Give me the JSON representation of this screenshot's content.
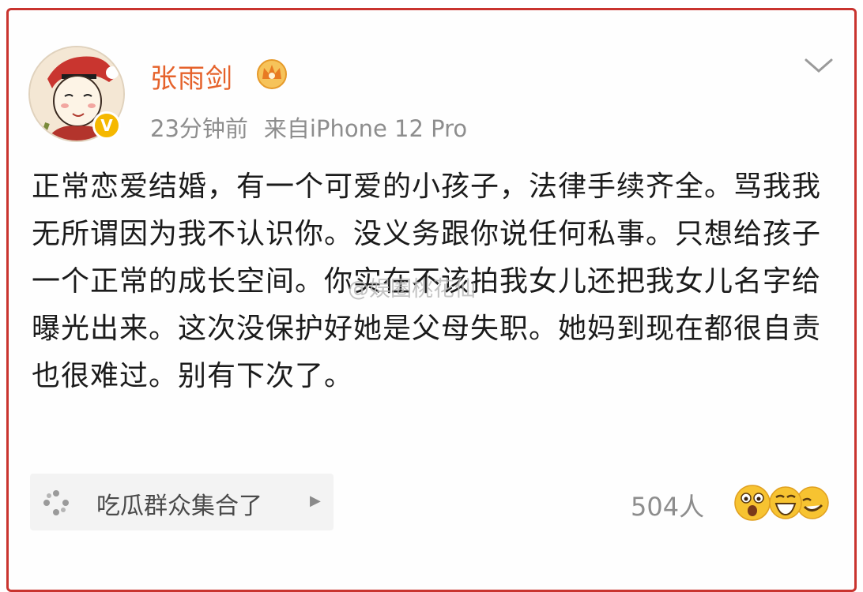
{
  "post": {
    "author": "张雨剑",
    "time": "23分钟前",
    "source": "来自iPhone 12 Pro",
    "text": "正常恋爱结婚，有一个可爱的小孩子，法律手续齐全。骂我我无所谓因为我不认识你。没义务跟你说任何私事。只想给孩子一个正常的成长空间。你实在不该拍我女儿还把我女儿名字给曝光出来。这次没保护好她是父母失职。她妈到现在都很自责也很难过。别有下次了。",
    "watermark": "@娱圈桃花仙"
  },
  "topic": {
    "label": "吃瓜群众集合了"
  },
  "reactions": {
    "count": "504人",
    "emoji_icons": [
      "shocked-face-icon",
      "laughing-face-icon",
      "grinning-face-icon"
    ]
  },
  "icons": {
    "verified": "verified-v-icon",
    "member_badge": "crown-badge-icon",
    "menu": "chevron-down-icon",
    "topic": "sparkle-icon"
  },
  "colors": {
    "username": "#e5622b",
    "frame": "#c9342f",
    "verified": "#f5b800",
    "meta": "#8d8d8d"
  }
}
